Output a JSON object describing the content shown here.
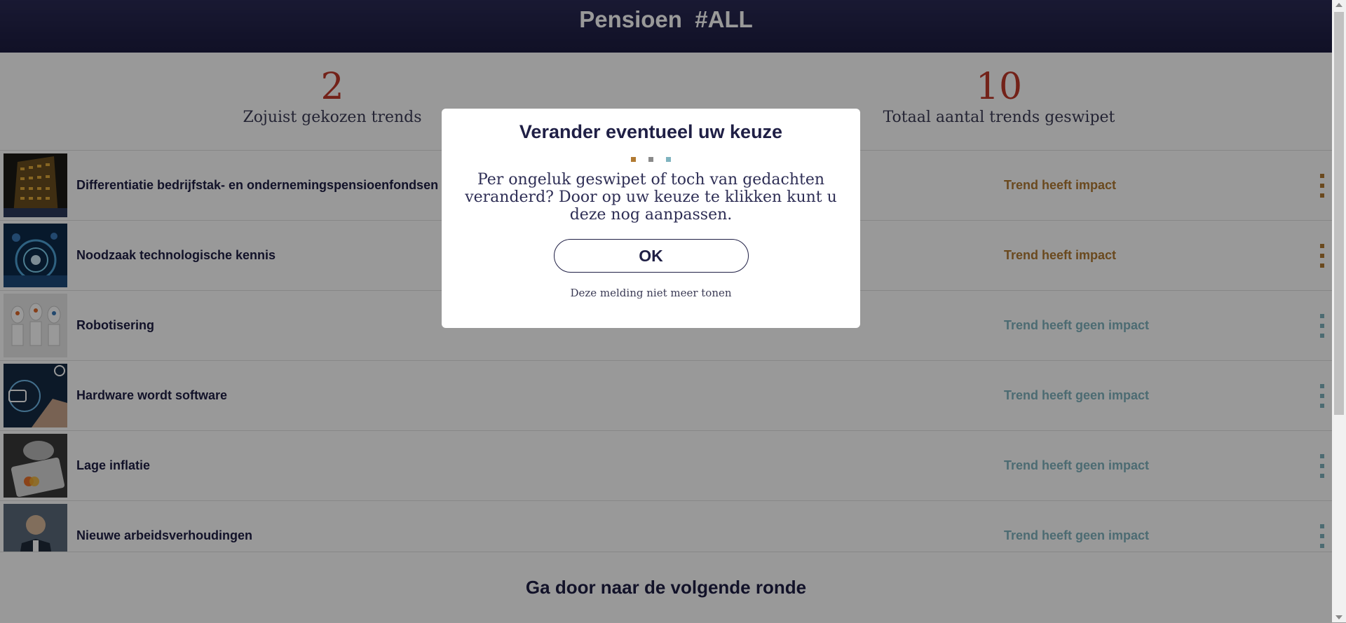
{
  "header": {
    "title": "Pensioen  #ALL"
  },
  "stats": [
    {
      "value": "2",
      "label": "Zojuist gekozen trends"
    },
    {
      "value": "10",
      "label": "Totaal aantal trends geswipet"
    }
  ],
  "trends": [
    {
      "title": "Differentiatie bedrijfstak- en ondernemingspensioenfondsen",
      "impact": "Trend heeft impact",
      "impact_type": "yes"
    },
    {
      "title": "Noodzaak technologische kennis",
      "impact": "Trend heeft impact",
      "impact_type": "yes"
    },
    {
      "title": "Robotisering",
      "impact": "Trend heeft geen impact",
      "impact_type": "no"
    },
    {
      "title": "Hardware wordt software",
      "impact": "Trend heeft geen impact",
      "impact_type": "no"
    },
    {
      "title": "Lage inflatie",
      "impact": "Trend heeft geen impact",
      "impact_type": "no"
    },
    {
      "title": "Nieuwe arbeidsverhoudingen",
      "impact": "Trend heeft geen impact",
      "impact_type": "no"
    }
  ],
  "footer": {
    "next_label": "Ga door naar de volgende ronde"
  },
  "modal": {
    "title": "Verander eventueel uw keuze",
    "text": "Per ongeluk geswipet of toch van gedachten veranderd? Door op uw keuze te klikken kunt u deze nog aanpassen.",
    "ok_label": "OK",
    "dont_show_label": "Deze melding niet meer tonen",
    "dot_colors": [
      "#b17a32",
      "#8a8a8a",
      "#7fb3bf"
    ]
  },
  "colors": {
    "impact": "#b17a32",
    "no_impact": "#7fb3bf",
    "stat_number": "#c0392b",
    "navy": "#1f1f45"
  }
}
